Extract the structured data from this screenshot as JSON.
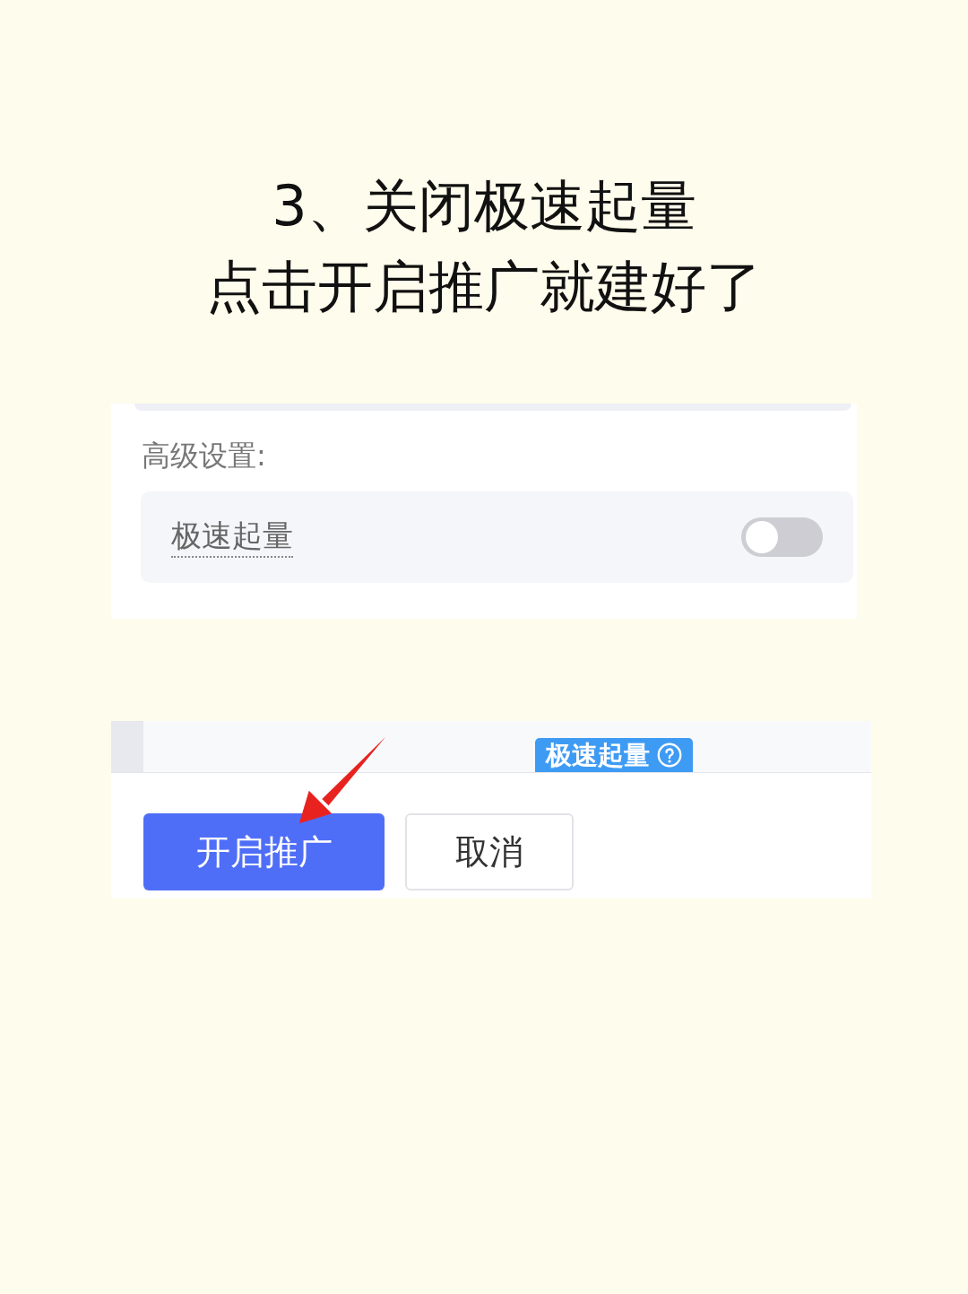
{
  "title": {
    "lines": [
      "3、关闭极速起量",
      "点击开启推广就建好了"
    ]
  },
  "settings_panel": {
    "heading": "高级设置:",
    "options": [
      {
        "kind": "switch",
        "label": "极速起量",
        "on": false
      }
    ]
  },
  "footer_panel": {
    "tag": {
      "label": "极速起量"
    },
    "buttons": [
      {
        "label": "开启推广",
        "kind": "primary"
      },
      {
        "label": "取消",
        "kind": "default"
      }
    ]
  }
}
